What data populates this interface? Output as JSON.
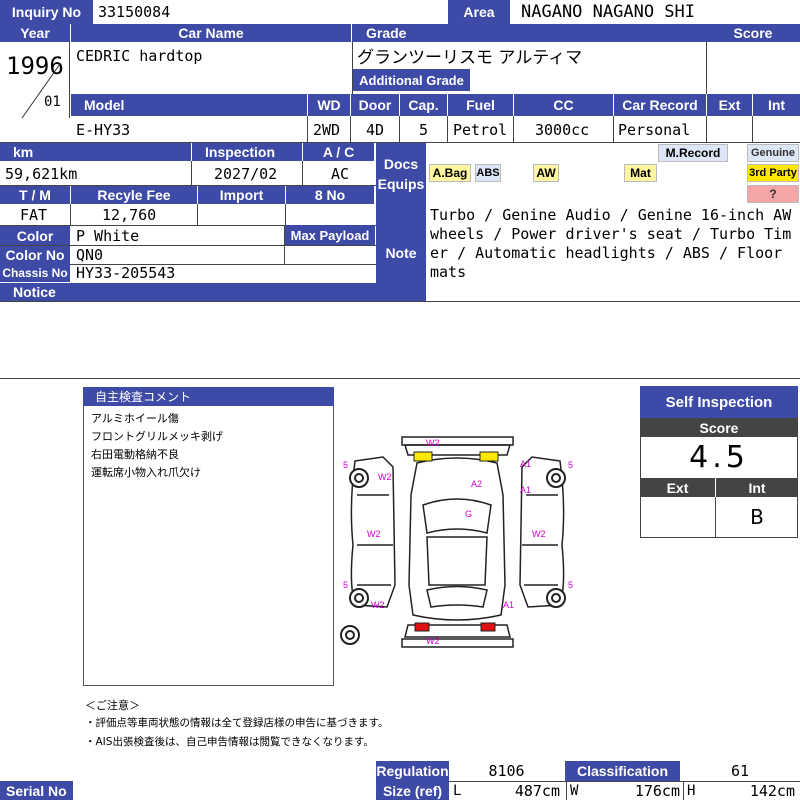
{
  "labels": {
    "inquiry_no": "Inquiry No",
    "area": "Area",
    "year": "Year",
    "car_name": "Car Name",
    "grade": "Grade",
    "score": "Score",
    "additional_grade": "Additional Grade",
    "model": "Model",
    "wd": "WD",
    "door": "Door",
    "cap": "Cap.",
    "fuel": "Fuel",
    "cc": "CC",
    "car_record": "Car Record",
    "ext": "Ext",
    "int": "Int",
    "km": "km",
    "inspection": "Inspection",
    "ac": "A / C",
    "docs": "Docs",
    "equips": "Equips",
    "tm": "T / M",
    "recycle_fee": "Recyle Fee",
    "import": "Import",
    "eight_no": "8 No",
    "color": "Color",
    "max_payload": "Max Payload",
    "color_no": "Color No",
    "note": "Note",
    "chassis_no": "Chassis No",
    "notice": "Notice",
    "regulation": "Regulation",
    "classification": "Classification",
    "size_ref": "Size (ref)",
    "serial_no": "Serial No",
    "size_l": "L",
    "size_w": "W",
    "size_h": "H"
  },
  "vehicle": {
    "inquiry_no": "33150084",
    "area": "NAGANO NAGANO SHI",
    "year": "1996",
    "month": "01",
    "car_name": "CEDRIC hardtop",
    "grade": "グランツーリスモ アルティマ",
    "model": "E-HY33",
    "wd": "2WD",
    "door": "4D",
    "cap": "5",
    "fuel": "Petrol",
    "cc": "3000cc",
    "car_record": "Personal",
    "km": "59,621km",
    "inspection": "2027/02",
    "ac": "AC",
    "tm": "FAT",
    "recycle_fee": "12,760",
    "color": "P White",
    "color_no": "QN0",
    "chassis_no": "HY33-205543",
    "note": "Turbo / Genine Audio / Genine 16-inch AW wheels / Power driver's seat / Turbo Timer / Automatic headlights / ABS / Floor mats"
  },
  "equips": {
    "abag": "A.Bag",
    "abs": "ABS",
    "aw": "AW",
    "mat": "Mat",
    "mrecord": "M.Record",
    "genuine": "Genuine",
    "third_party": "3rd Party",
    "unknown": "?"
  },
  "comments": {
    "title": "自主検査コメント",
    "items": [
      "アルミホイール傷",
      "フロントグリルメッキ剥げ",
      "右田電動格納不良",
      "運転席小物入れ爪欠け"
    ]
  },
  "notes_jp": {
    "title": "＜ご注意＞",
    "line1": "・評価点等車両状態の情報は全て登録店様の申告に基づきます。",
    "line2": "・AIS出張検査後は、自己申告情報は閲覧できなくなります。"
  },
  "self_inspection": {
    "title": "Self Inspection",
    "score_label": "Score",
    "score": "4.5",
    "ext_label": "Ext",
    "int_label": "Int",
    "ext": "",
    "int": "B"
  },
  "footer": {
    "regulation": "8106",
    "classification": "61",
    "length": "487cm",
    "width": "176cm",
    "height": "142cm"
  },
  "damage_marks": [
    "W2",
    "A2",
    "A1",
    "A1",
    "G",
    "W2",
    "W2",
    "W2",
    "W2",
    "A1",
    "W2",
    "5",
    "5",
    "5",
    "5"
  ],
  "colors": {
    "label_bg": "#3d4aa6",
    "mark_yellow": "#ffe800",
    "mark_red": "#e01010",
    "mark_text": "#cc00cc"
  }
}
